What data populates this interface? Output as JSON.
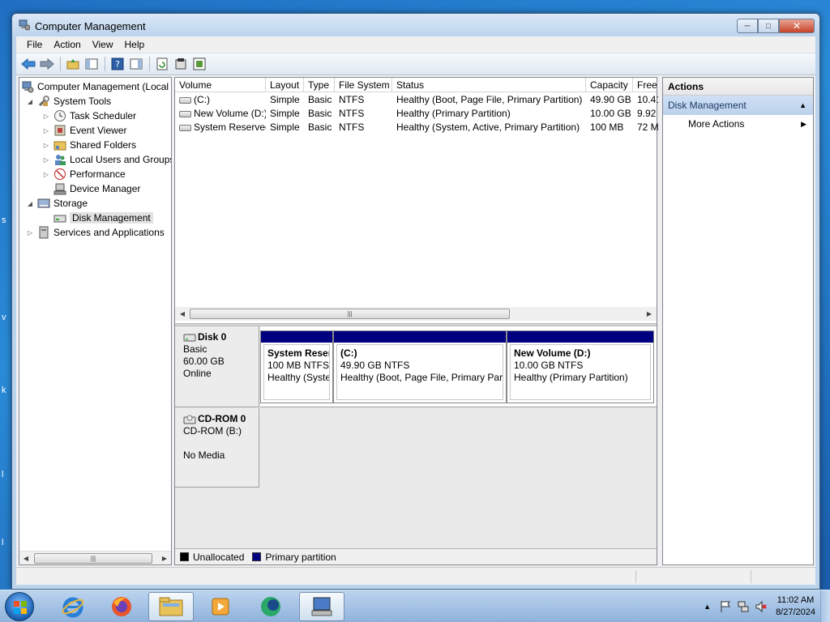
{
  "window": {
    "title": "Computer Management"
  },
  "menu": [
    "File",
    "Action",
    "View",
    "Help"
  ],
  "tree": {
    "root": "Computer Management (Local",
    "system_tools": "System Tools",
    "task_scheduler": "Task Scheduler",
    "event_viewer": "Event Viewer",
    "shared_folders": "Shared Folders",
    "local_users": "Local Users and Groups",
    "performance": "Performance",
    "device_manager": "Device Manager",
    "storage": "Storage",
    "disk_management": "Disk Management",
    "services": "Services and Applications"
  },
  "volumes": {
    "columns": [
      "Volume",
      "Layout",
      "Type",
      "File System",
      "Status",
      "Capacity",
      "Free"
    ],
    "rows": [
      [
        "(C:)",
        "Simple",
        "Basic",
        "NTFS",
        "Healthy (Boot, Page File, Primary Partition)",
        "49.90 GB",
        "10.41"
      ],
      [
        "New Volume (D:)",
        "Simple",
        "Basic",
        "NTFS",
        "Healthy (Primary Partition)",
        "10.00 GB",
        "9.92"
      ],
      [
        "System Reserved",
        "Simple",
        "Basic",
        "NTFS",
        "Healthy (System, Active, Primary Partition)",
        "100 MB",
        "72 M"
      ]
    ]
  },
  "disks": {
    "disk0": {
      "name": "Disk 0",
      "type": "Basic",
      "size": "60.00 GB",
      "state": "Online"
    },
    "cdrom0": {
      "name": "CD-ROM 0",
      "type": "CD-ROM (B:)",
      "state": "No Media"
    },
    "partitions": [
      {
        "name": "System Reser",
        "size": "100 MB NTFS",
        "status": "Healthy (Syste"
      },
      {
        "name": "(C:)",
        "size": "49.90 GB NTFS",
        "status": "Healthy (Boot, Page File, Primary Part"
      },
      {
        "name": "New Volume  (D:)",
        "size": "10.00 GB NTFS",
        "status": "Healthy (Primary Partition)"
      }
    ]
  },
  "legend": {
    "unallocated": "Unallocated",
    "primary": "Primary partition"
  },
  "actions": {
    "title": "Actions",
    "section": "Disk Management",
    "more": "More Actions"
  },
  "clock": {
    "time": "11:02 AM",
    "date": "8/27/2024"
  },
  "colors": {
    "partition_bar": "#000080",
    "unallocated": "#000000"
  }
}
